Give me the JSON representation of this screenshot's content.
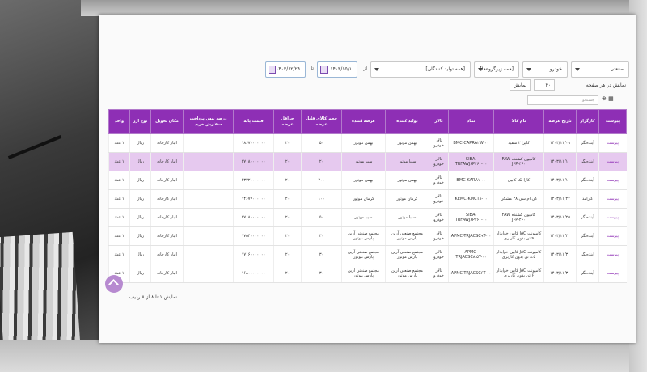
{
  "filters": {
    "category": "صنعتی",
    "vehicle": "خودرو",
    "subgroup": "[همه زیرگروه‌ها]",
    "producer": "[همه تولید کنندگان]",
    "from_label": "از",
    "from_date": "۱۴۰۳/۱۵/۱",
    "to_label": "تا",
    "to_date": "۱۴۰۳/۱۲/۲۹"
  },
  "pager": {
    "per_page_label": "نمایش در هر صفحه",
    "per_page_value": "۲۰",
    "show_button": "نمایش"
  },
  "search": {
    "placeholder": "جستجو"
  },
  "table": {
    "headers": [
      "پیوست",
      "کارگزار",
      "تاریخ عرضه",
      "نام کالا",
      "نماد",
      "تالار",
      "تولید کننده",
      "عرضه کننده",
      "حجم کالای قابل عرضه",
      "حداقل عرضه",
      "قیمت پایه",
      "درصد پیش پرداخت سفارش خرید",
      "مکان تحویل",
      "نوع ارز",
      "واحد"
    ],
    "rows": [
      [
        "پیوست",
        "آینده‌نگر",
        "۱۴۰۳/۱۱/۰۹",
        "کاپرا ۲ سفید",
        "BMC-CAPRA۲W-۰۰",
        "تالار خودرو",
        "بهمن موتور",
        "بهمن موتور",
        "۵۰",
        "۲۰",
        "۱۸۶۷۰۰۰۰۰۰۰",
        "",
        "انبار کارخانه",
        "ریال",
        "۱ عدد"
      ],
      [
        "پیوست",
        "آینده‌نگر",
        "۱۴۰۳/۱۱/۱۰",
        "کامیون کشنده FAW J۶P-۴۶۰",
        "SIBA-TRFAWJ۶P۴۶۰-۰۰",
        "تالار خودرو",
        "سیبا موتور",
        "سیبا موتور",
        "۲۰",
        "۲۰",
        "۳۷۰۸۰۰۰۰۰۰۰",
        "",
        "انبار کارخانه",
        "ریال",
        "۱ عدد"
      ],
      [
        "پیوست",
        "آینده‌نگر",
        "۱۴۰۳/۱۱/۱۱",
        "کارا تک کابین",
        "BMC-KARA۱-۰۰",
        "تالار خودرو",
        "بهمن موتور",
        "بهمن موتور",
        "۲۰۰",
        "۲۰",
        "۴۳۳۲۰۰۰۰۰۰۰",
        "",
        "انبار کارخانه",
        "ریال",
        "۱ عدد"
      ],
      [
        "پیوست",
        "کارامد",
        "۱۴۰۳/۱۱/۲۴",
        "کی ام سی ۲۸ مشکی",
        "KEMC-KMCT۸-۰۰",
        "تالار خودرو",
        "کرمان موتور",
        "کرمان موتور",
        "۱۰۰",
        "۲۰",
        "۱۴۶۷۹۰۰۰۰۰۰",
        "",
        "انبار کارخانه",
        "ریال",
        "۱ عدد"
      ],
      [
        "پیوست",
        "آینده‌نگر",
        "۱۴۰۳/۱۱/۲۵",
        "کامیون کشنده FAW J۶P-۴۶۰",
        "SIBA-TRFAWJ۶P۴۶۰-۰۰",
        "تالار خودرو",
        "سیبا موتور",
        "سیبا موتور",
        "۵۰",
        "۲۰",
        "۳۷۰۸۰۰۰۰۰۰۰",
        "",
        "انبار کارخانه",
        "ریال",
        "۱ عدد"
      ],
      [
        "پیوست",
        "آینده‌نگر",
        "۱۴۰۳/۱۱/۳۰",
        "کامیونت JAC کابین خوابدار ۹ تن بدون کاربری",
        "APMC-TRJACSC۹T-۰۰",
        "تالار خودرو",
        "مجتمع صنعتی آرین پارس موتور",
        "مجتمع صنعتی آرین پارس موتور",
        "۳۰",
        "۲۰",
        "۱۷۵۴۰۰۰۰۰۰۰",
        "",
        "انبار کارخانه",
        "ریال",
        "۱ عدد"
      ],
      [
        "پیوست",
        "آینده‌نگر",
        "۱۴۰۳/۱۱/۳۰",
        "کامیونت JAC کابین خوابدار ۸.۵ تن بدون کاربری",
        "APMC-TRJACSC۸.۵T-۰۰",
        "تالار خودرو",
        "مجتمع صنعتی آرین پارس موتور",
        "مجتمع صنعتی آرین پارس موتور",
        "۳۰",
        "۲۰",
        "۱۷۱۶۰۰۰۰۰۰۰",
        "",
        "انبار کارخانه",
        "ریال",
        "۱ عدد"
      ],
      [
        "پیوست",
        "آینده‌نگر",
        "۱۴۰۳/۱۱/۳۰",
        "کامیونت JAC کابین خوابدار ۶ تن بدون کاربری",
        "APMC-TRJACSC۶T-۰۰",
        "تالار خودرو",
        "مجتمع صنعتی آرین پارس موتور",
        "مجتمع صنعتی آرین پارس موتور",
        "۳۰",
        "۲۰",
        "۱۶۸۰۰۰۰۰۰۰۰",
        "",
        "انبار کارخانه",
        "ریال",
        "۱ عدد"
      ]
    ],
    "selected_row": 1
  },
  "footer": {
    "summary": "نمایش ۱ تا ۸ از ۸ ردیف"
  },
  "colors": {
    "header": "#8e2fb5",
    "selected": "#e6c9ef",
    "link": "#8e2fb5"
  }
}
